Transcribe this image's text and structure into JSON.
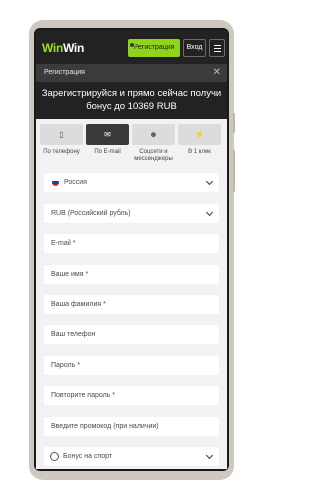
{
  "header": {
    "logo_part1": "Win",
    "logo_part2": "Win",
    "register_label": "Регистрация",
    "login_label": "Вход"
  },
  "modal": {
    "title": "Регистрация",
    "close_glyph": "✕",
    "promo_text": "Зарегистрируйся и прямо сейчас получи бонус до 10369 RUB"
  },
  "tabs": [
    {
      "label": "По телефону",
      "icon": "phone-icon",
      "glyph": "▯"
    },
    {
      "label": "По E-mail",
      "icon": "envelope-icon",
      "glyph": "✉"
    },
    {
      "label": "Соцсети и мессенджеры",
      "icon": "users-icon",
      "glyph": "☻"
    },
    {
      "label": "В 1 клик",
      "icon": "lightning-icon",
      "glyph": "⚡"
    }
  ],
  "form": {
    "country": "Россия",
    "currency": "RUB (Российский рубль)",
    "email": "E-mail  *",
    "name": "Ваше имя  *",
    "surname": "Ваша фамилия  *",
    "phone": "Ваш телефон",
    "password": "Пароль  *",
    "repeat_password": "Повторите пароль  *",
    "promocode": "Введите промокод (при наличии)",
    "bonus": "Бонус на спорт"
  },
  "colors": {
    "accent": "#8ed41a",
    "header_bg": "#222222",
    "flag_white": "#ffffff",
    "flag_blue": "#1c3fa8",
    "flag_red": "#d52b1e"
  }
}
